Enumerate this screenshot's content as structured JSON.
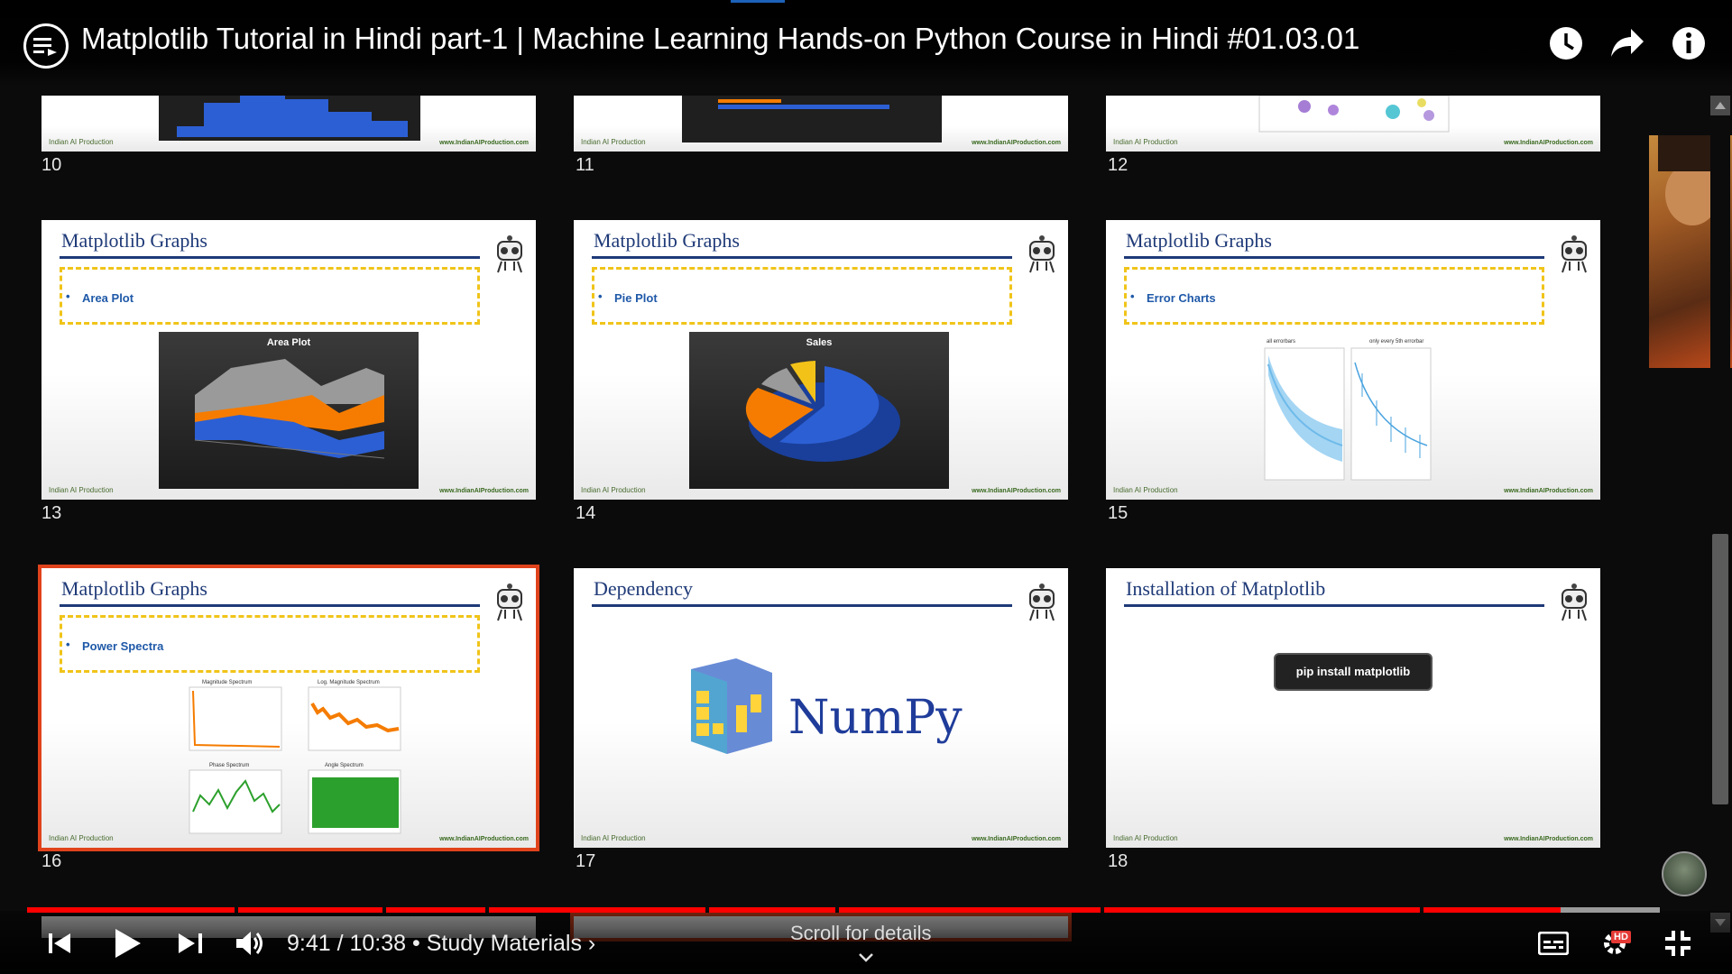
{
  "header": {
    "video_title": "Matplotlib Tutorial in Hindi part-1 | Machine Learning Hands-on Python Course in Hindi #01.03.01"
  },
  "slides": {
    "row1": {
      "s10": "10",
      "s11": "11",
      "s12": "12"
    },
    "s13": {
      "number": "13",
      "title": "Matplotlib Graphs",
      "bullet": "Area Plot",
      "chart_title": "Area Plot"
    },
    "s14": {
      "number": "14",
      "title": "Matplotlib Graphs",
      "bullet": "Pie Plot",
      "chart_title": "Sales"
    },
    "s15": {
      "number": "15",
      "title": "Matplotlib Graphs",
      "bullet": "Error Charts",
      "panel_left": "all errorbars",
      "panel_right": "only every 5th errorbar"
    },
    "s16": {
      "number": "16",
      "title": "Matplotlib Graphs",
      "bullet": "Power Spectra",
      "p1": "Magnitude Spectrum",
      "p2": "Log. Magnitude Spectrum",
      "p3": "Phase Spectrum",
      "p4": "Angle Spectrum"
    },
    "s17": {
      "number": "17",
      "title": "Dependency",
      "logo_text": "NumPy"
    },
    "s18": {
      "number": "18",
      "title": "Installation of Matplotlib",
      "command": "pip install matplotlib"
    },
    "footer_left": "Indian AI Production",
    "footer_right": "www.IndianAIProduction.com"
  },
  "controls": {
    "time": "9:41 / 10:38 • Study Materials ›",
    "scroll_hint": "Scroll for details",
    "hd": "HD"
  },
  "colors": {
    "accent_red": "#e53935",
    "selected_border": "#e0431c",
    "title_blue": "#1f3a78"
  }
}
